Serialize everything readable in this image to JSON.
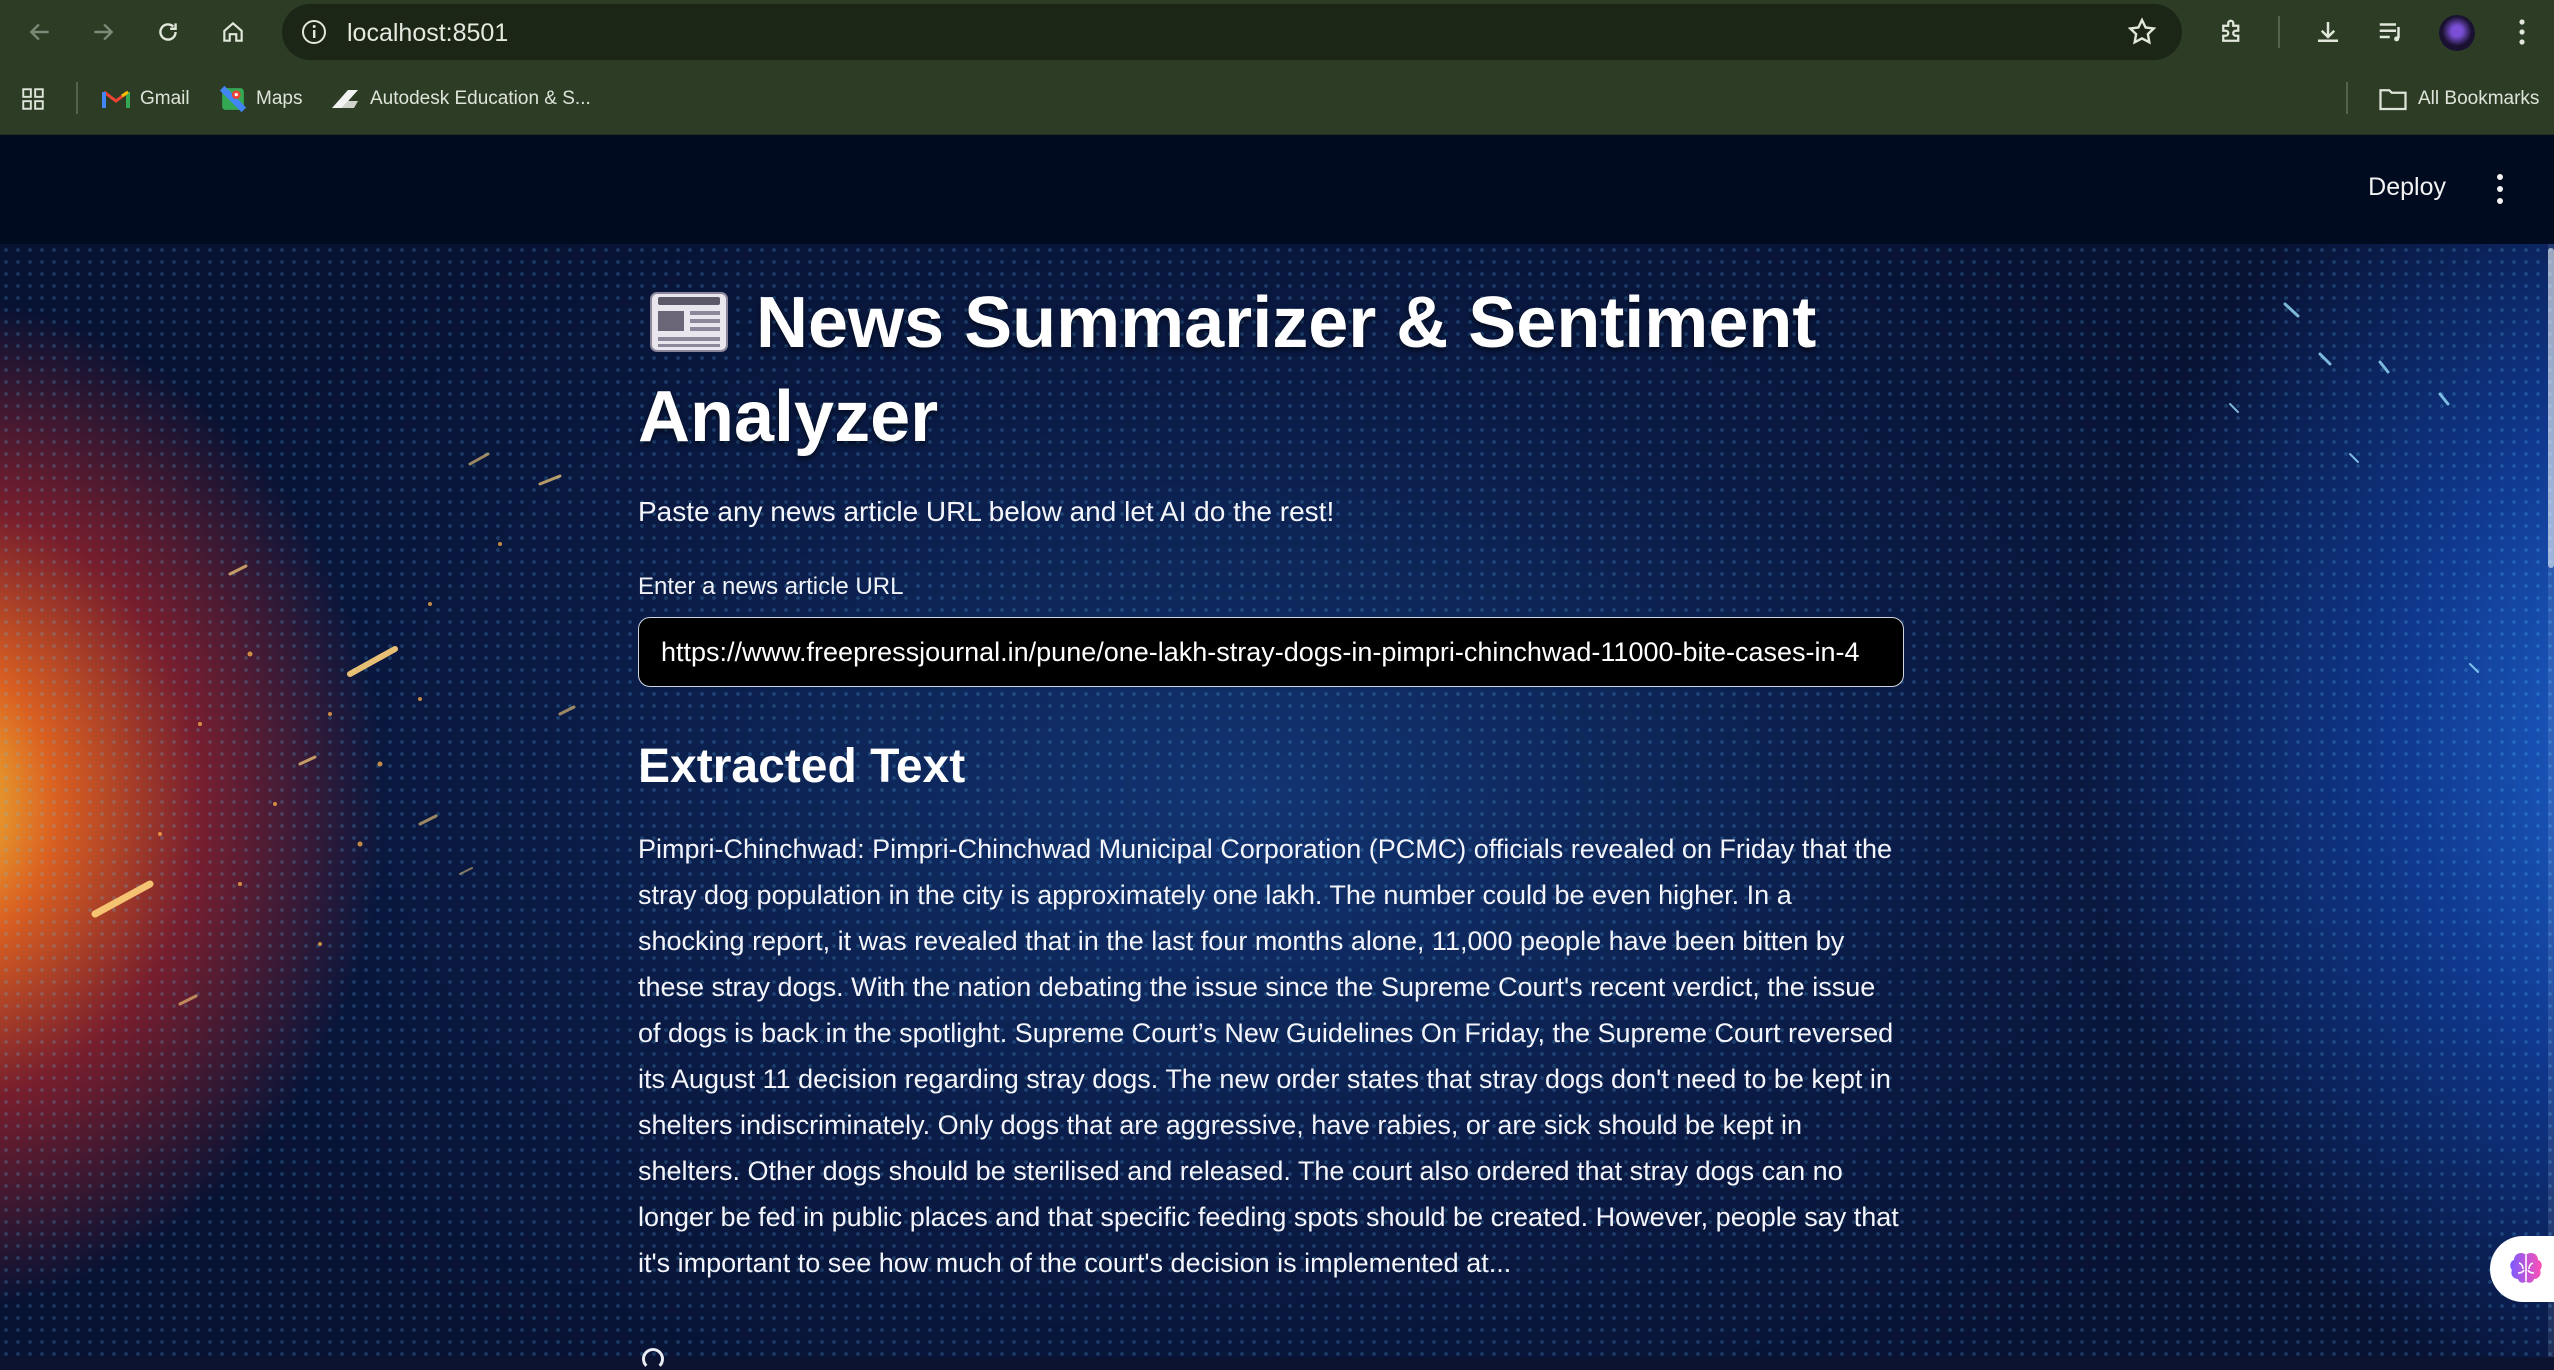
{
  "browser": {
    "url": "localhost:8501",
    "bookmarks": [
      {
        "label": "Gmail",
        "icon": "gmail-icon"
      },
      {
        "label": "Maps",
        "icon": "maps-icon"
      },
      {
        "label": "Autodesk Education & S...",
        "icon": "autodesk-icon"
      }
    ],
    "all_bookmarks": "All Bookmarks"
  },
  "header": {
    "deploy_label": "Deploy",
    "menu_icon": "kebab-menu-icon"
  },
  "main": {
    "title": "News Summarizer & Sentiment Analyzer",
    "title_icon": "newspaper-icon",
    "intro": "Paste any news article URL below and let AI do the rest!",
    "url_field": {
      "label": "Enter a news article URL",
      "value": "https://www.freepressjournal.in/pune/one-lakh-stray-dogs-in-pimpri-chinchwad-11000-bite-cases-in-4"
    },
    "extracted_heading": "Extracted Text",
    "extracted_text": "Pimpri-Chinchwad: Pimpri-Chinchwad Municipal Corporation (PCMC) officials revealed on Friday that the stray dog population in the city is approximately one lakh. The number could be even higher. In a shocking report, it was revealed that in the last four months alone, 11,000 people have been bitten by these stray dogs. With the nation debating the issue since the Supreme Court's recent verdict, the issue of dogs is back in the spotlight. Supreme Court’s New Guidelines On Friday, the Supreme Court reversed its August 11 decision regarding stray dogs. The new order states that stray dogs don't need to be kept in shelters indiscriminately. Only dogs that are aggressive, have rabies, or are sick should be kept in shelters. Other dogs should be sterilised and released. The court also ordered that stray dogs can no longer be fed in public places and that specific feeding spots should be created. However, people say that it's important to see how much of the court's decision is implemented at..."
  },
  "colors": {
    "browser_chrome": "#2c3c25",
    "app_header": "#000b1f",
    "input_bg": "#000000"
  }
}
